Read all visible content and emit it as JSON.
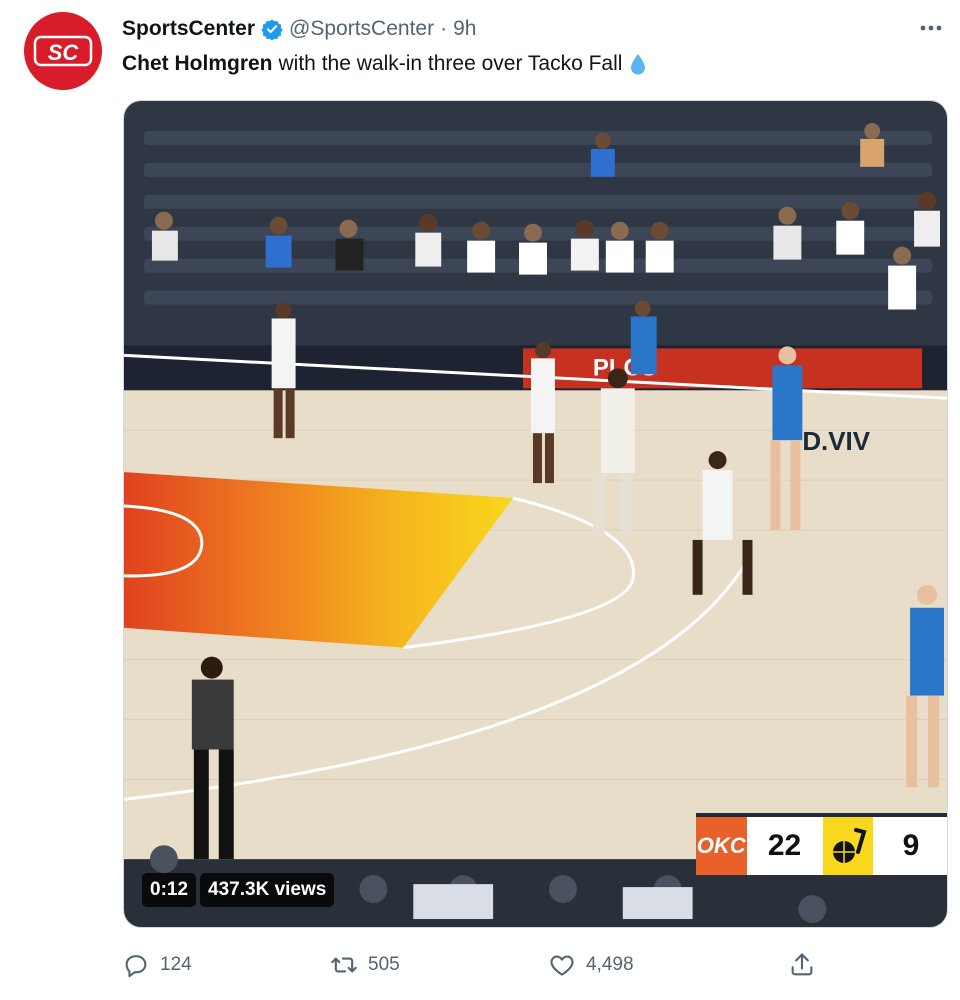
{
  "tweet": {
    "author_name": "SportsCenter",
    "author_handle": "@SportsCenter",
    "separator": "·",
    "time": "9h",
    "text_bold": "Chet Holmgren",
    "text_rest": "with the walk-in three over Tacko Fall",
    "emoji": "droplet"
  },
  "avatar": {
    "logo_text": "SC",
    "color": "#d91c2a"
  },
  "video": {
    "timestamp": "0:12",
    "views": "437.3K views"
  },
  "scorebug": {
    "team1_logo": "OKC",
    "team1_score": "22",
    "team2_score": "9",
    "team1_color": "#e8602a",
    "team2_color": "#f9d71c"
  },
  "actions": {
    "replies": "124",
    "retweets": "505",
    "likes": "4,498"
  },
  "colors": {
    "verified": "#1d9bf0",
    "secondary_text": "#536471"
  }
}
